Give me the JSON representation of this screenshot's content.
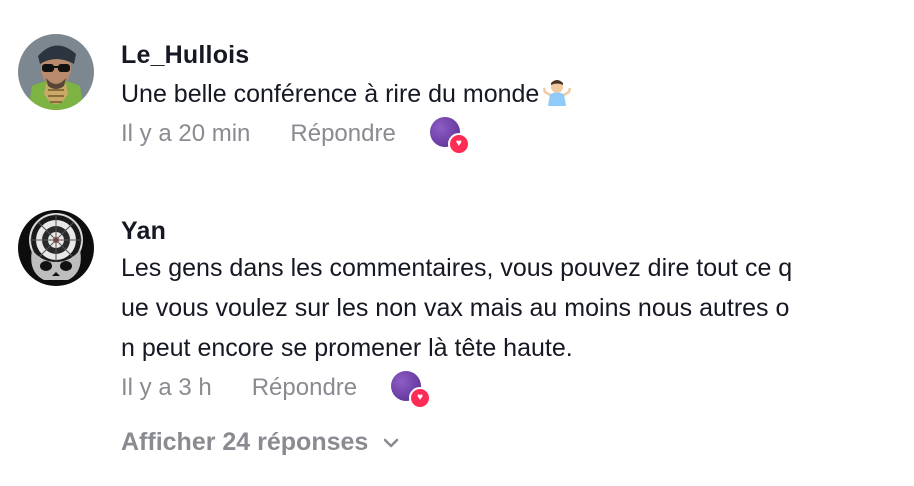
{
  "comments": [
    {
      "username": "Le_Hullois",
      "text": "Une belle conférence à rire du monde",
      "emoji": "shrugging-person-emoji",
      "time": "Il y a 20 min",
      "reply_label": "Répondre",
      "liked_by_creator": true
    },
    {
      "username": "Yan",
      "text": "Les gens dans les commentaires, vous pouvez dire tout ce q\nue vous voulez sur les non vax mais au moins nous autres o\nn peut encore se promener là tête haute.",
      "time": "Il y a 3 h",
      "reply_label": "Répondre",
      "liked_by_creator": true
    }
  ],
  "view_replies": {
    "label": "Afficher 24 réponses",
    "icon": "chevron-down-icon"
  },
  "colors": {
    "text_primary": "#161823",
    "text_secondary": "#8a8b91",
    "heart_badge": "#fe2c55",
    "liked_avatar": "#6b3fa3"
  }
}
